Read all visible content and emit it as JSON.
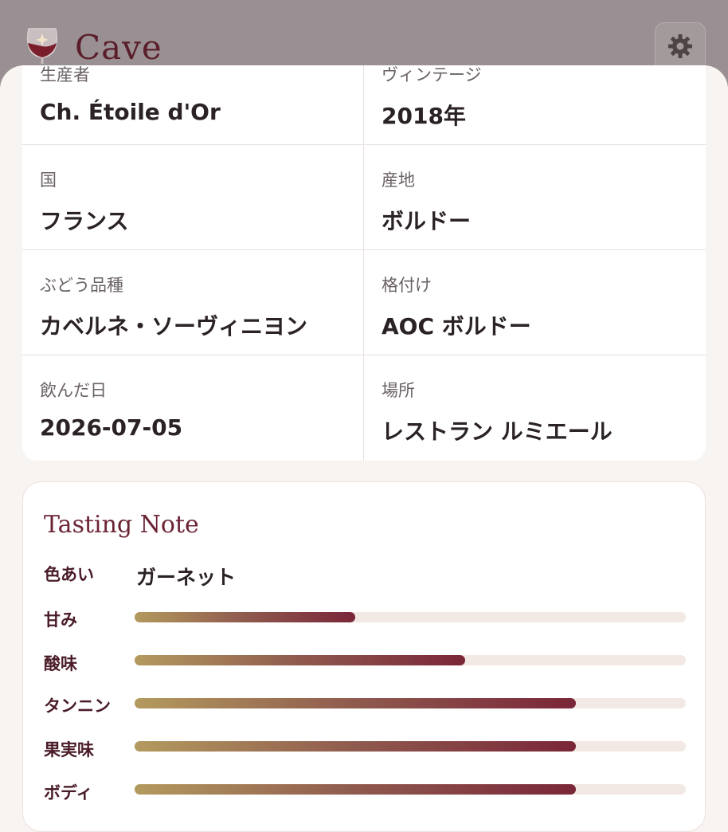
{
  "app": {
    "title": "Cave",
    "logo_icon": "wine-glass-icon",
    "settings_icon": "gear-icon"
  },
  "info": [
    {
      "label": "生産者",
      "value": "Ch. Étoile d'Or"
    },
    {
      "label": "ヴィンテージ",
      "value": "2018年"
    },
    {
      "label": "国",
      "value": "フランス"
    },
    {
      "label": "産地",
      "value": "ボルドー"
    },
    {
      "label": "ぶどう品種",
      "value": "カベルネ・ソーヴィニヨン"
    },
    {
      "label": "格付け",
      "value": "AOC ボルドー"
    },
    {
      "label": "飲んだ日",
      "value": "2026-07-05"
    },
    {
      "label": "場所",
      "value": "レストラン ルミエール"
    }
  ],
  "tasting": {
    "title": "Tasting Note",
    "color_label": "色あい",
    "color_value": "ガーネット",
    "bars": [
      {
        "label": "甘み",
        "level": 0.4
      },
      {
        "label": "酸味",
        "level": 0.6
      },
      {
        "label": "タンニン",
        "level": 0.8
      },
      {
        "label": "果実味",
        "level": 0.8
      },
      {
        "label": "ボディ",
        "level": 0.8
      }
    ]
  },
  "colors": {
    "accent": "#6b2434",
    "header_overlay": "#9a9093",
    "bar_track": "#f2e9e4"
  }
}
